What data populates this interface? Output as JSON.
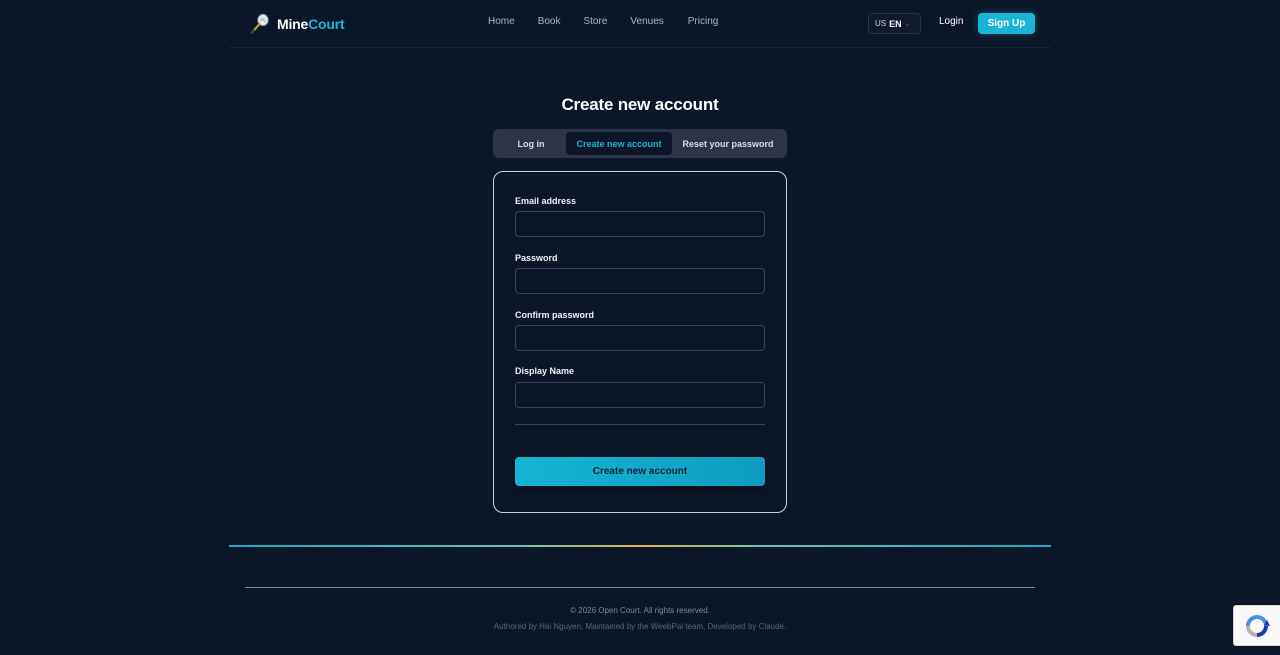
{
  "header": {
    "logo_part1": "Mine",
    "logo_part2": "Court",
    "nav": [
      "Home",
      "Book",
      "Store",
      "Venues",
      "Pricing"
    ],
    "language": {
      "flag": "US",
      "code": "EN"
    },
    "login_label": "Login",
    "signup_label": "Sign Up"
  },
  "main": {
    "title": "Create new account",
    "tabs": [
      {
        "label": "Log in",
        "active": false
      },
      {
        "label": "Create new account",
        "active": true
      },
      {
        "label": "Reset your password",
        "active": false
      }
    ],
    "form": {
      "email_label": "Email address",
      "email_value": "",
      "password_label": "Password",
      "password_value": "",
      "confirm_label": "Confirm password",
      "confirm_value": "",
      "display_name_label": "Display Name",
      "display_name_value": "",
      "submit_label": "Create new account"
    }
  },
  "footer": {
    "copyright": "© 2026 Open Court. All rights reserved.",
    "credits": "Authored by Hai Nguyen, Maintained by the WeebPal team, Developed by Claude."
  },
  "colors": {
    "background": "#0c1629",
    "accent": "#19b5d4",
    "tab_bar": "#2b3547",
    "highlight": "#e0b84a"
  },
  "icons": {
    "logo": "badminton-racket-icon",
    "language_chevron": "chevron-down-icon",
    "recaptcha": "recaptcha-icon"
  }
}
